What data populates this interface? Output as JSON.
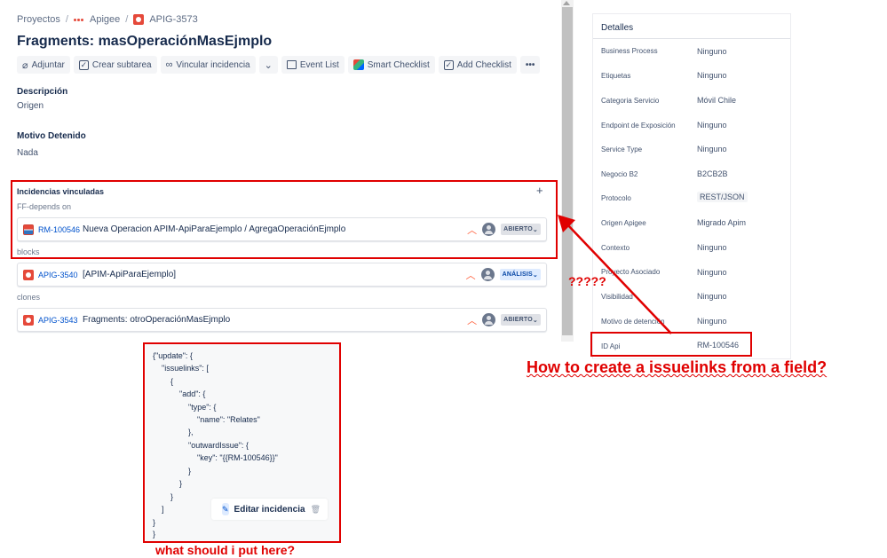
{
  "breadcrumb": {
    "projects": "Proyectos",
    "project": "Apigee",
    "issue_key": "APIG-3573"
  },
  "page_title": "Fragments: masOperaciónMasEjmplo",
  "toolbar": {
    "attach": "Adjuntar",
    "create_subtask": "Crear subtarea",
    "link_issue": "Vincular incidencia",
    "event_list": "Event List",
    "smart_checklist": "Smart Checklist",
    "add_checklist": "Add Checklist",
    "more": "•••"
  },
  "description": {
    "label": "Descripción",
    "value": "Origen"
  },
  "motivo_detenido": {
    "label": "Motivo Detenido",
    "value": "Nada"
  },
  "linked_issues": {
    "title": "Incidencias vinculadas",
    "add": "+",
    "groups": [
      {
        "relation": "FF-depends on",
        "key": "RM-100546",
        "summary": "Nueva Operacion APIM-ApiParaEjemplo / AgregaOperaciónEjmplo",
        "status": "ABIERTO",
        "icon": "story-icon"
      },
      {
        "relation": "blocks",
        "key": "APIG-3540",
        "summary": "[APIM-ApiParaEjemplo]",
        "status": "ANÁLISIS",
        "icon": "bug-icon"
      },
      {
        "relation": "clones",
        "key": "APIG-3543",
        "summary": "Fragments: otroOperaciónMasEjmplo",
        "status": "ABIERTO",
        "icon": "bug-icon"
      }
    ]
  },
  "details": {
    "title": "Detalles",
    "fields": [
      {
        "label": "Business Process",
        "value": "Ninguno"
      },
      {
        "label": "Etiquetas",
        "value": "Ninguno"
      },
      {
        "label": "Categoria Servicio",
        "value": "Móvil Chile"
      },
      {
        "label": "Endpoint de Exposición",
        "value": "Ninguno"
      },
      {
        "label": "Service Type",
        "value": "Ninguno"
      },
      {
        "label": "Negocio B2",
        "value": "B2CB2B"
      },
      {
        "label": "Protocolo",
        "value": "REST/JSON"
      },
      {
        "label": "Origen Apigee",
        "value": "Migrado Apim"
      },
      {
        "label": "Contexto",
        "value": "Ninguno"
      },
      {
        "label": "Proyecto Asociado",
        "value": "Ninguno"
      },
      {
        "label": "Visibilidad",
        "value": "Ninguno"
      },
      {
        "label": "Motivo de detención",
        "value": "Ninguno"
      },
      {
        "label": "ID Api",
        "value": "RM-100546"
      }
    ]
  },
  "json_editor": {
    "lines": [
      "{\"update\": {",
      "    \"issuelinks\": [",
      "        {",
      "            \"add\": {",
      "                \"type\": {",
      "                    \"name\": \"Relates\"",
      "                },",
      "                \"outwardIssue\": {",
      "                    \"key\": \"{{RM-100546}}\"",
      "                }",
      "            }",
      "        }",
      "    ]",
      "}",
      "}"
    ],
    "edit_button": "Editar incidencia"
  },
  "annotations": {
    "question_marks": "?????",
    "main_question": "How to create a issuelinks from a field?",
    "bottom_question": "what should i put here?"
  },
  "colors": {
    "annotation_red": "#e00000",
    "link_blue": "#0052cc",
    "priority_orange": "#ff5630"
  }
}
